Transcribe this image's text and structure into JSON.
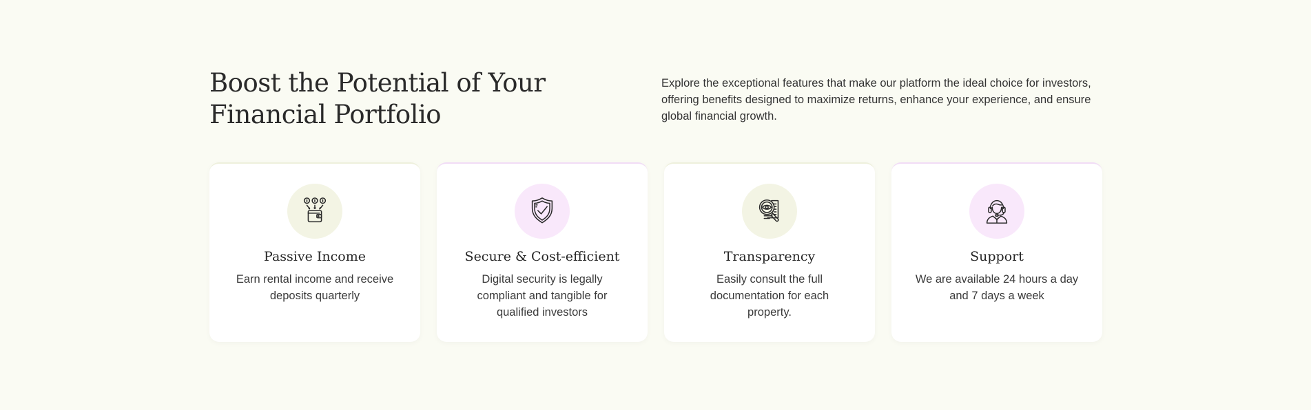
{
  "header": {
    "title_line1": "Boost the Potential of Your",
    "title_line2": "Financial Portfolio",
    "description": "Explore the exceptional features that make our platform the ideal choice for investors, offering benefits designed to maximize returns, enhance your experience, and ensure global financial growth."
  },
  "features": [
    {
      "icon": "wallet-coins-icon",
      "title": "Passive Income",
      "text": "Earn rental income and receive deposits quarterly"
    },
    {
      "icon": "shield-check-icon",
      "title": "Secure & Cost-efficient",
      "text": "Digital security is legally compliant and tangible for qualified investors"
    },
    {
      "icon": "magnifier-document-icon",
      "title": "Transparency",
      "text": "Easily consult the full documentation for each property."
    },
    {
      "icon": "support-agent-icon",
      "title": "Support",
      "text": "We are available 24 hours a day and 7 days a week"
    }
  ],
  "colors": {
    "background": "#fafbf3",
    "card": "#ffffff",
    "icon_bg_olive": "#f3f4e4",
    "icon_bg_pink": "#f9e8fb",
    "text": "#2b2b2b"
  }
}
